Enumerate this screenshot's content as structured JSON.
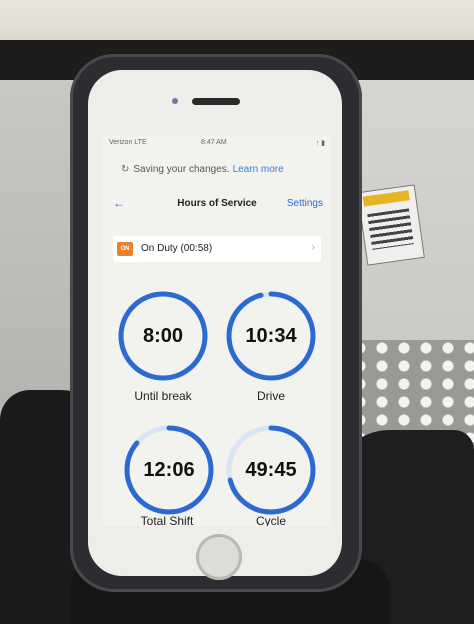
{
  "status_bar": {
    "carrier": "Verizon  LTE",
    "time": "8:47 AM",
    "right": "↑ ▮"
  },
  "saving": {
    "text": "Saving your changes.",
    "link": "Learn more",
    "spinner_icon": "spinner-icon"
  },
  "nav": {
    "back_icon": "←",
    "title": "Hours of Service",
    "settings": "Settings"
  },
  "duty": {
    "badge": "ON",
    "status": "On Duty (00:58)",
    "chevron": "›"
  },
  "colors": {
    "accent": "#2c6ad1",
    "ring_track": "#d9e4f5",
    "badge": "#e8812a"
  },
  "dials": [
    {
      "value": "8:00",
      "label": "Until break",
      "progress": 1.0
    },
    {
      "value": "10:34",
      "label": "Drive",
      "progress": 0.96
    },
    {
      "value": "12:06",
      "label": "Total Shift",
      "progress": 0.86
    },
    {
      "value": "49:45",
      "label": "Cycle",
      "progress": 0.71
    }
  ]
}
